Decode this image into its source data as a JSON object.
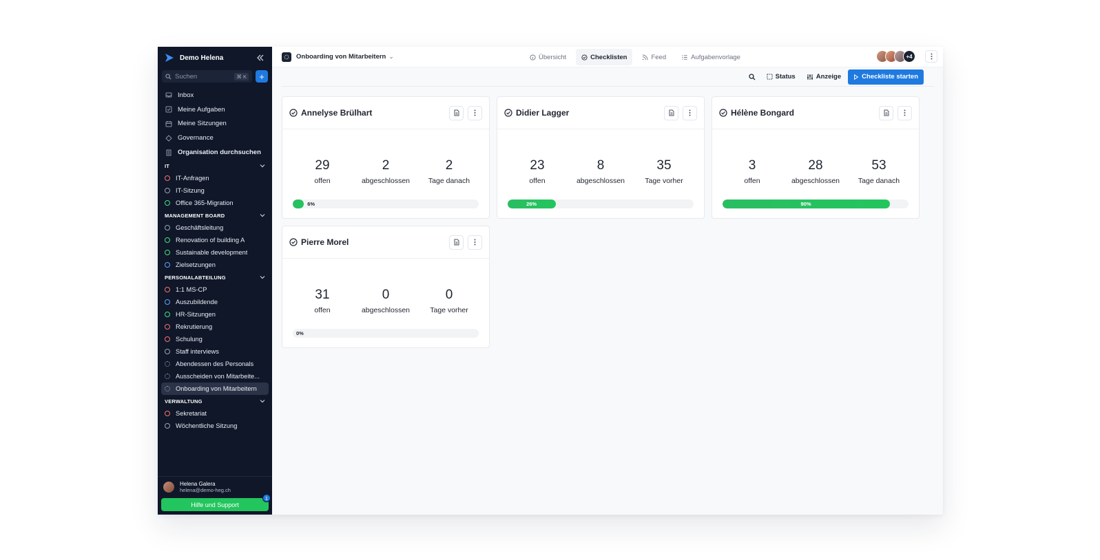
{
  "workspace": "Demo Helena",
  "search": {
    "placeholder": "Suchen",
    "shortcut": "⌘ K"
  },
  "nav": [
    {
      "label": "Inbox",
      "icon": "inbox-icon",
      "bold": false
    },
    {
      "label": "Meine Aufgaben",
      "icon": "task-icon",
      "bold": false
    },
    {
      "label": "Meine Sitzungen",
      "icon": "calendar-icon",
      "bold": false
    },
    {
      "label": "Governance",
      "icon": "governance-icon",
      "bold": false
    },
    {
      "label": "Organisation durchsuchen",
      "icon": "building-icon",
      "bold": true
    }
  ],
  "sections": [
    {
      "title": "IT",
      "items": [
        {
          "label": "IT-Anfragen",
          "color": "#f87171",
          "style": "solid"
        },
        {
          "label": "IT-Sitzung",
          "color": "#9aa3b4",
          "style": "solid"
        },
        {
          "label": "Office 365-Migration",
          "color": "#4ade80",
          "style": "solid"
        }
      ]
    },
    {
      "title": "MANAGEMENT BOARD",
      "items": [
        {
          "label": "Geschäftsleitung",
          "color": "#9aa3b4",
          "style": "solid"
        },
        {
          "label": "Renovation of building A",
          "color": "#4ade80",
          "style": "solid"
        },
        {
          "label": "Sustainable development",
          "color": "#4ade80",
          "style": "solid"
        },
        {
          "label": "Zielsetzungen",
          "color": "#60a5fa",
          "style": "solid"
        }
      ]
    },
    {
      "title": "PERSONALABTEILUNG",
      "items": [
        {
          "label": "1:1 MS-CP",
          "color": "#f87171",
          "style": "solid"
        },
        {
          "label": "Auszubildende",
          "color": "#60a5fa",
          "style": "solid"
        },
        {
          "label": "HR-Sitzungen",
          "color": "#4ade80",
          "style": "solid"
        },
        {
          "label": "Rekrutierung",
          "color": "#f87171",
          "style": "solid"
        },
        {
          "label": "Schulung",
          "color": "#f87171",
          "style": "solid"
        },
        {
          "label": "Staff interviews",
          "color": "#9aa3b4",
          "style": "solid"
        },
        {
          "label": "Abendessen des Personals",
          "color": "#9aa3b4",
          "style": "dashed"
        },
        {
          "label": "Ausscheiden von Mitarbeite...",
          "color": "#9aa3b4",
          "style": "dashed"
        },
        {
          "label": "Onboarding von Mitarbeitern",
          "color": "#9aa3b4",
          "style": "dashed",
          "active": true
        }
      ]
    },
    {
      "title": "VERWALTUNG",
      "items": [
        {
          "label": "Sekretariat",
          "color": "#f87171",
          "style": "solid"
        },
        {
          "label": "Wöchentliche Sitzung",
          "color": "#9aa3b4",
          "style": "solid"
        }
      ]
    }
  ],
  "user": {
    "name": "Helena Galera",
    "email": "helena@demo-heg.ch"
  },
  "help": {
    "label": "Hilfe und Support",
    "badge": "1"
  },
  "header": {
    "title": "Onboarding von Mitarbeitern",
    "tabs": [
      {
        "label": "Übersicht",
        "icon": "info-icon",
        "active": false
      },
      {
        "label": "Checklisten",
        "icon": "check-circle-icon",
        "active": true
      },
      {
        "label": "Feed",
        "icon": "rss-icon",
        "active": false
      },
      {
        "label": "Aufgabenvorlage",
        "icon": "list-icon",
        "active": false
      }
    ],
    "avatars_more": "+4"
  },
  "toolbar": {
    "status": "Status",
    "display": "Anzeige",
    "start": "Checkliste starten"
  },
  "checklists": [
    {
      "name": "Annelyse Brülhart",
      "stats": [
        {
          "value": "29",
          "label": "offen"
        },
        {
          "value": "2",
          "label": "abgeschlossen"
        },
        {
          "value": "2",
          "label": "Tage danach"
        }
      ],
      "progress": 6,
      "progress_label": "6%"
    },
    {
      "name": "Didier Lagger",
      "stats": [
        {
          "value": "23",
          "label": "offen"
        },
        {
          "value": "8",
          "label": "abgeschlossen"
        },
        {
          "value": "35",
          "label": "Tage vorher"
        }
      ],
      "progress": 26,
      "progress_label": "26%"
    },
    {
      "name": "Hélène Bongard",
      "stats": [
        {
          "value": "3",
          "label": "offen"
        },
        {
          "value": "28",
          "label": "abgeschlossen"
        },
        {
          "value": "53",
          "label": "Tage danach"
        }
      ],
      "progress": 90,
      "progress_label": "90%"
    },
    {
      "name": "Pierre Morel",
      "stats": [
        {
          "value": "31",
          "label": "offen"
        },
        {
          "value": "0",
          "label": "abgeschlossen"
        },
        {
          "value": "0",
          "label": "Tage vorher"
        }
      ],
      "progress": 0,
      "progress_label": "0%"
    }
  ]
}
